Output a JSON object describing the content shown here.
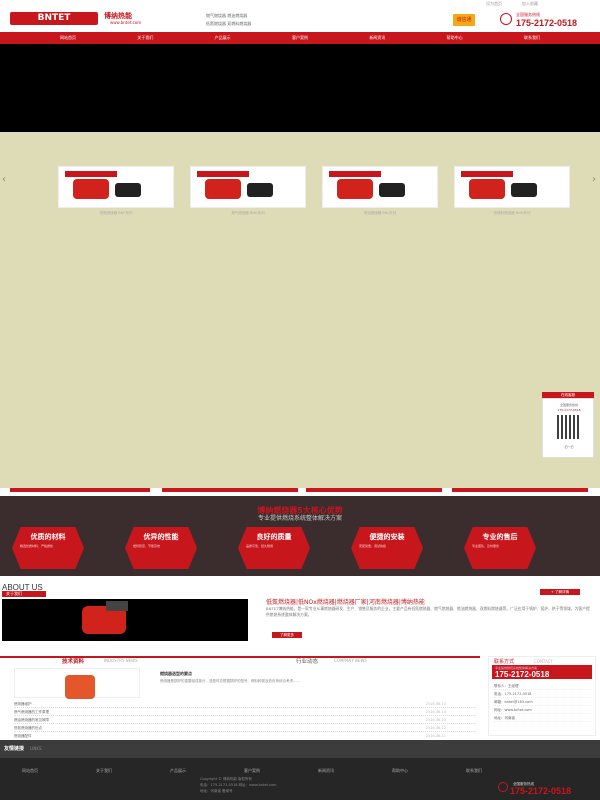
{
  "topbar": {
    "link1": "设为首页",
    "link2": "加入收藏"
  },
  "header": {
    "logo": "BNTET",
    "name_cn": "博纳热能",
    "url": "www.bntet.com",
    "info1": "燃气燃烧器  燃油燃烧器",
    "info2": "低氮燃烧器  双燃料燃烧器",
    "badge": "诚信通",
    "phone_label": "全国服务热线",
    "phone": "175-2172-0518"
  },
  "nav": [
    "网站首页",
    "关于我们",
    "产品展示",
    "客户案例",
    "新闻资讯",
    "帮助中心",
    "联系我们"
  ],
  "products": [
    {
      "caption": "低氮燃烧器 BNF系列"
    },
    {
      "caption": "燃气燃烧器 BNG系列"
    },
    {
      "caption": "燃油燃烧器 BNL系列"
    },
    {
      "caption": "双燃料燃烧器 BND系列"
    }
  ],
  "qr": {
    "title": "在线客服",
    "text": "全国服务热线",
    "phone": "175-2172-0518",
    "scan": "扫一扫"
  },
  "advantages": {
    "title": "博纳燃烧器5大核心优势",
    "subtitle": "专业提供燃烧系统整体解决方案",
    "items": [
      {
        "title": "优质的材料",
        "desc": "精选优质材料，严格质检"
      },
      {
        "title": "优异的性能",
        "desc": "燃烧稳定，节能高效"
      },
      {
        "title": "良好的质量",
        "desc": "品质可靠，经久耐用"
      },
      {
        "title": "便捷的安装",
        "desc": "安装简便，调试快捷"
      },
      {
        "title": "专业的售后",
        "desc": "专业团队，及时服务"
      }
    ]
  },
  "about": {
    "en": "ABOUT US",
    "cn": "关于我们",
    "title": "低氮燃烧器|低NOx燃烧器|燃烧器厂家|河南燃烧器|博纳热能",
    "text": "BNTET博纳热能，是一家专业从事燃烧器研发、生产、销售及服务的企业，主要产品有低氮燃烧器、燃气燃烧器、燃油燃烧器、双燃料燃烧器等，广泛应用于锅炉、窑炉、烘干等领域，为客户提供燃烧系统整体解决方案。",
    "more": "了解更多",
    "more2": "+ 了解详情"
  },
  "news": {
    "tab1": "技术资料",
    "tab1_en": "INDUSTRY NEWS",
    "tab2": "行业动态",
    "tab2_en": "COMPANY NEWS",
    "head": "燃烧器选型的要点",
    "desc": "燃烧器是锅炉的重要组成部分，选型时应根据锅炉的型号、燃料种类及热负荷综合考虑……",
    "items": [
      {
        "t": "燃烧器维护",
        "d": "2016-06-15"
      },
      {
        "t": "燃气燃烧器的工作原理",
        "d": "2016-06-14"
      },
      {
        "t": "燃油燃烧器的常见故障",
        "d": "2016-06-13"
      },
      {
        "t": "低氮燃烧器的优点",
        "d": "2016-06-12"
      },
      {
        "t": "燃烧器配件",
        "d": "2016-06-11"
      }
    ]
  },
  "contact": {
    "title": "联系方式",
    "title_en": "CONTACT",
    "phone_label": "专业提供燃烧系统整体解决方案",
    "phone": "175-2172-0518",
    "lines": [
      "联系人：王经理",
      "电话：175-2172-0518",
      "邮箱：bntet@163.com",
      "网址：www.bntet.com",
      "地址：河南省"
    ]
  },
  "links": {
    "title": "友情链接",
    "en": "LINKS"
  },
  "footer": {
    "nav": [
      "网站首页",
      "关于我们",
      "产品展示",
      "客户案例",
      "新闻资讯",
      "帮助中心",
      "联系我们"
    ],
    "line1": "Copyright © 博纳热能 版权所有",
    "line2": "电话：175-2172-0518  网址：www.bntet.com",
    "line3": "地址：河南省  备案号",
    "phone_label": "全国服务热线",
    "phone": "175-2172-0518"
  }
}
